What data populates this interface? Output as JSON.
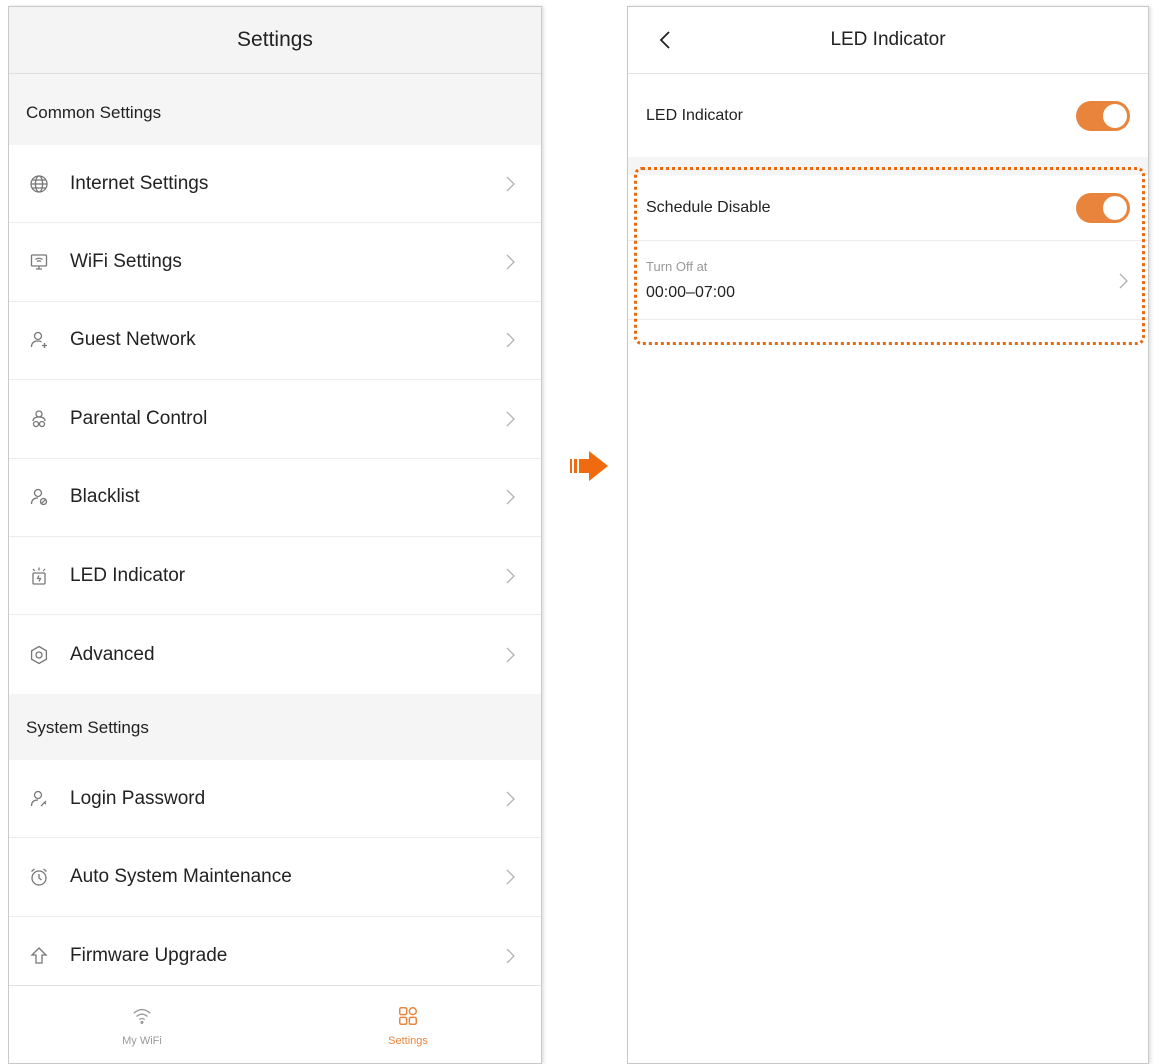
{
  "left_screen": {
    "title": "Settings",
    "common_header": "Common Settings",
    "common_items": [
      {
        "label": "Internet Settings",
        "icon": "globe-icon"
      },
      {
        "label": "WiFi Settings",
        "icon": "router-icon"
      },
      {
        "label": "Guest Network",
        "icon": "guest-user-icon"
      },
      {
        "label": "Parental Control",
        "icon": "parental-icon"
      },
      {
        "label": "Blacklist",
        "icon": "blacklist-user-icon"
      },
      {
        "label": "LED Indicator",
        "icon": "led-lamp-icon"
      },
      {
        "label": "Advanced",
        "icon": "hexagon-icon"
      }
    ],
    "system_header": "System Settings",
    "system_items": [
      {
        "label": "Login Password",
        "icon": "user-key-icon"
      },
      {
        "label": "Auto System Maintenance",
        "icon": "alarm-clock-icon"
      },
      {
        "label": "Firmware Upgrade",
        "icon": "upgrade-arrow-icon"
      }
    ],
    "tabs": [
      {
        "label": "My WiFi",
        "icon": "wifi-icon",
        "active": false
      },
      {
        "label": "Settings",
        "icon": "grid-icon",
        "active": true
      }
    ]
  },
  "right_screen": {
    "title": "LED Indicator",
    "led_indicator": {
      "label": "LED Indicator",
      "enabled": true
    },
    "schedule_disable": {
      "label": "Schedule Disable",
      "enabled": true
    },
    "turn_off": {
      "caption": "Turn Off at",
      "value": "00:00–07:00"
    }
  },
  "colors": {
    "accent": "#e8843c",
    "arrow": "#f06a10",
    "highlight_border": "#e86a10",
    "inactive_tab": "#9a9a9a",
    "chevron": "#b0b0b0"
  }
}
